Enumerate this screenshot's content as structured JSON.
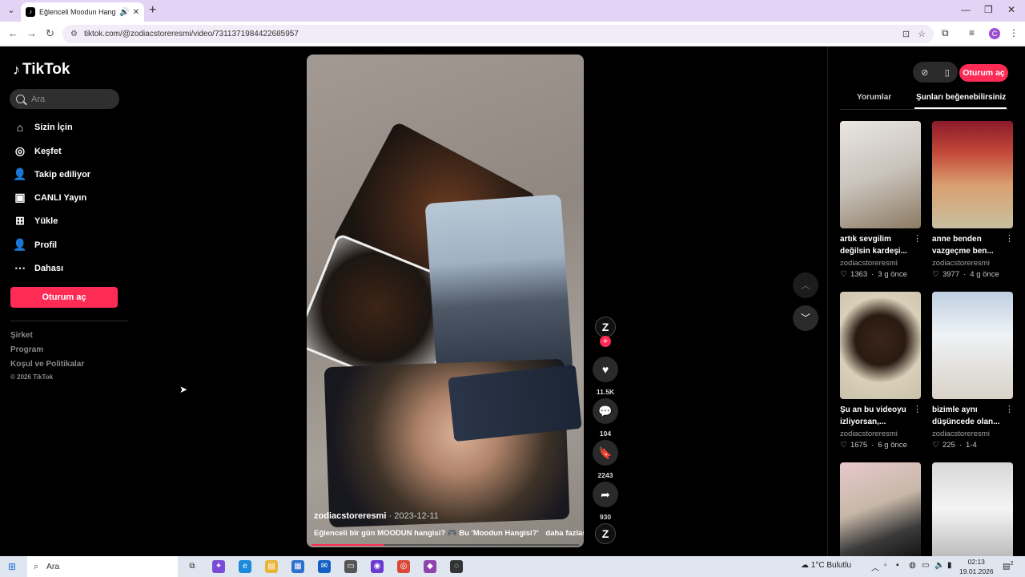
{
  "browser": {
    "tab_title": "Eğlenceli Moodun Hangisi",
    "url": "tiktok.com/@zodiacstoreresmi/video/7311371984422685957",
    "profile_initial": "C"
  },
  "sidebar": {
    "logo": "TikTok",
    "search_placeholder": "Ara",
    "items": [
      {
        "label": "Sizin İçin",
        "icon": "home-icon"
      },
      {
        "label": "Keşfet",
        "icon": "compass-icon"
      },
      {
        "label": "Takip ediliyor",
        "icon": "following-icon"
      },
      {
        "label": "CANLI Yayın",
        "icon": "live-icon"
      },
      {
        "label": "Yükle",
        "icon": "upload-icon"
      },
      {
        "label": "Profil",
        "icon": "profile-icon"
      },
      {
        "label": "Dahası",
        "icon": "more-icon"
      }
    ],
    "login_label": "Oturum aç",
    "footer_links": [
      "Şirket",
      "Program",
      "Koşul ve Politikalar"
    ],
    "copyright": "© 2026 TikTok"
  },
  "video": {
    "username": "zodiacstoreresmi",
    "date": "2023-12-11",
    "description": "Eğlenceli bir gün MOODUN hangisi? 🎮 Bu 'Moodun Hangisi?'",
    "more_label": "daha fazlası",
    "progress": 0.27,
    "avatar_letter": "Z",
    "likes": "11.5K",
    "comments": "104",
    "saves": "2243",
    "shares": "930"
  },
  "right_panel": {
    "login_label": "Oturum aç",
    "tabs": [
      "Yorumlar",
      "Şunları beğenebilirsiniz"
    ],
    "active_tab": 1,
    "recommendations": [
      {
        "title": "artık sevgilim değilsin kardeşi...",
        "user": "zodiacstoreresmi",
        "likes": "1363",
        "age": "3 g önce"
      },
      {
        "title": "anne benden vazgeçme ben...",
        "user": "zodiacstoreresmi",
        "likes": "3977",
        "age": "4 g önce"
      },
      {
        "title": "Şu an bu videoyu izliyorsan,...",
        "user": "zodiacstoreresmi",
        "likes": "1675",
        "age": "6 g önce"
      },
      {
        "title": "bizimle aynı düşüncede olan...",
        "user": "zodiacstoreresmi",
        "likes": "225",
        "age": "1-4"
      }
    ]
  },
  "taskbar": {
    "search_placeholder": "Ara",
    "weather": "1°C  Bulutlu",
    "time": "02:13",
    "date": "19.01.2026",
    "notification_count": "2"
  },
  "colors": {
    "accent": "#fe2c55",
    "background": "#000000",
    "tabbar": "#e3d3f5"
  }
}
